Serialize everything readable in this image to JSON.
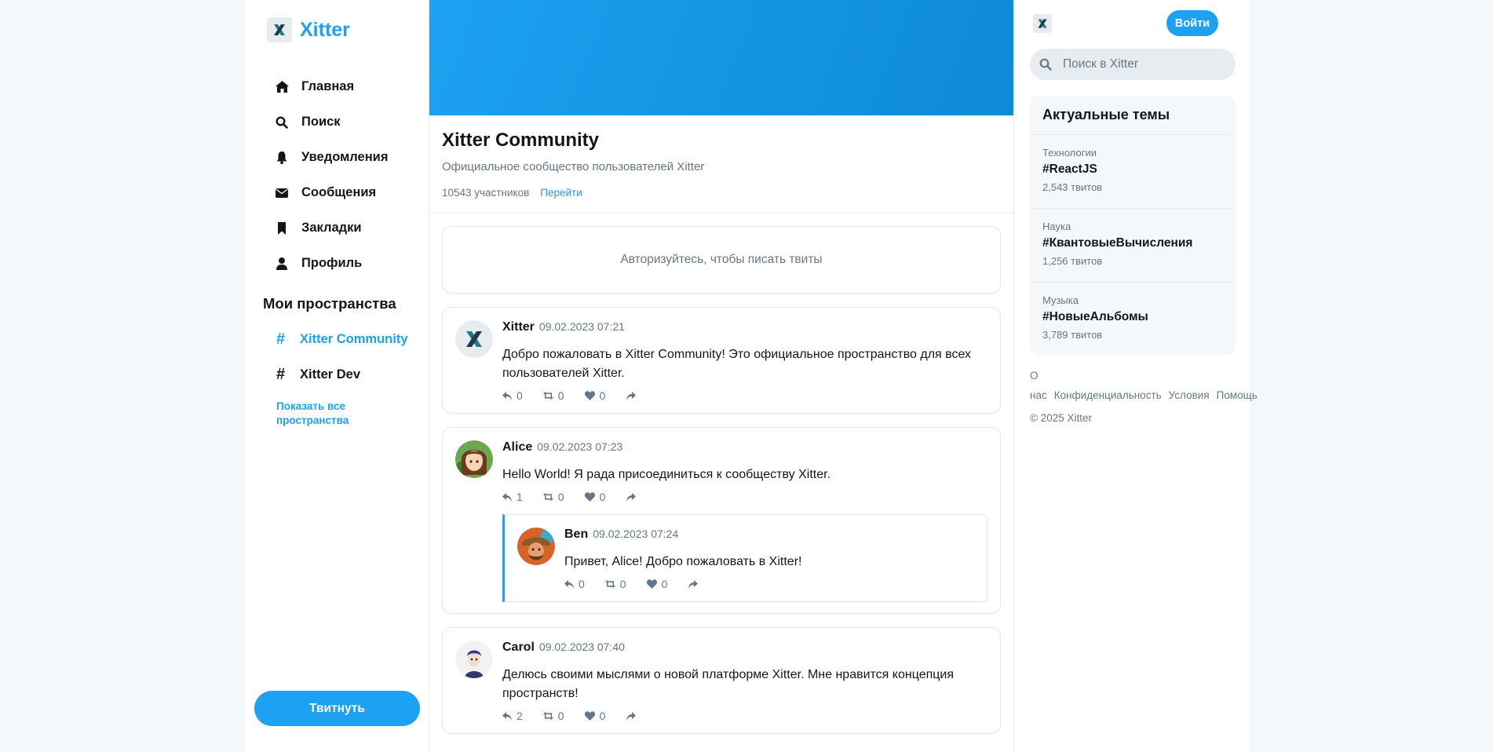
{
  "brand": {
    "name": "Xitter"
  },
  "nav": [
    {
      "label": "Главная",
      "icon": "home-icon"
    },
    {
      "label": "Поиск",
      "icon": "search-icon"
    },
    {
      "label": "Уведомления",
      "icon": "bell-icon"
    },
    {
      "label": "Сообщения",
      "icon": "envelope-icon"
    },
    {
      "label": "Закладки",
      "icon": "bookmark-icon"
    },
    {
      "label": "Профиль",
      "icon": "user-icon"
    }
  ],
  "spaces": {
    "title": "Мои пространства",
    "items": [
      {
        "hash": "#",
        "label": "Xitter Community"
      },
      {
        "hash": "#",
        "label": "Xitter Dev"
      }
    ],
    "show_all": "Показать все пространства"
  },
  "tweet_button": "Твитнуть",
  "community": {
    "title": "Xitter Community",
    "description": "Официальное сообщество пользователей Xitter",
    "members": "10543 участников",
    "go_link": "Перейти"
  },
  "auth_prompt": "Авторизуйтесь, чтобы писать твиты",
  "tweets": [
    {
      "name": "Xitter",
      "time": "09.02.2023 07:21",
      "text": "Добро пожаловать в Xitter Community! Это официальное пространство для всех пользователей Xitter.",
      "replies": "0",
      "retweets": "0",
      "likes": "0"
    },
    {
      "name": "Alice",
      "time": "09.02.2023 07:23",
      "text": "Hello World! Я рада присоединиться к сообществу Xitter.",
      "replies": "1",
      "retweets": "0",
      "likes": "0",
      "reply": {
        "name": "Ben",
        "time": "09.02.2023 07:24",
        "text": "Привет, Alice! Добро пожаловать в Xitter!",
        "replies": "0",
        "retweets": "0",
        "likes": "0"
      }
    },
    {
      "name": "Carol",
      "time": "09.02.2023 07:40",
      "text": "Делюсь своими мыслями о новой платформе Xitter. Мне нравится концепция пространств!",
      "replies": "2",
      "retweets": "0",
      "likes": "0"
    }
  ],
  "right": {
    "login": "Войти",
    "search_placeholder": "Поиск в Xitter",
    "trends_title": "Актуальные темы",
    "trends": [
      {
        "category": "Технологии",
        "tag": "#ReactJS",
        "count": "2,543 твитов"
      },
      {
        "category": "Наука",
        "tag": "#КвантовыеВычисления",
        "count": "1,256 твитов"
      },
      {
        "category": "Музыка",
        "tag": "#НовыеАльбомы",
        "count": "3,789 твитов"
      }
    ],
    "footer": [
      "О нас",
      "Конфиденциальность",
      "Условия",
      "Помощь"
    ],
    "copyright": "© 2025 Xitter"
  },
  "colors": {
    "accent": "#1da1f2",
    "text": "#14171a",
    "muted": "#657786",
    "background": "#f5f8fa"
  }
}
